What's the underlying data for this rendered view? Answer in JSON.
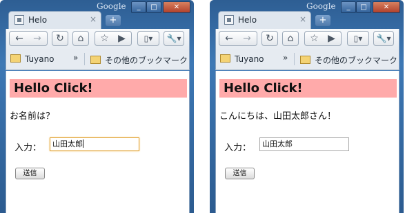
{
  "windows": [
    {
      "brand": "Google",
      "tab_title": "Helo",
      "bookmarks": [
        "Tuyano",
        "その他のブックマーク"
      ],
      "chevron": "»",
      "heading": "Hello Click!",
      "message": "お名前は？",
      "input_label": "入力：",
      "input_value": "山田太郎",
      "submit_label": "送信"
    },
    {
      "brand": "Google",
      "tab_title": "Helo",
      "bookmarks": [
        "Tuyano",
        "その他のブックマーク"
      ],
      "chevron": "»",
      "heading": "Hello Click!",
      "message": "こんにちは、山田太郎さん！",
      "input_label": "入力：",
      "input_value": "山田太郎",
      "submit_label": "送信"
    }
  ],
  "icons": [
    "back-icon",
    "forward-icon",
    "reload-icon",
    "home-icon",
    "star-icon",
    "play-icon",
    "page-menu-icon",
    "wrench-icon",
    "folder-icon"
  ],
  "colors": {
    "heading_bg": "#ffaaaa",
    "frame": "#3d78b5",
    "focus": "#e0a030"
  }
}
